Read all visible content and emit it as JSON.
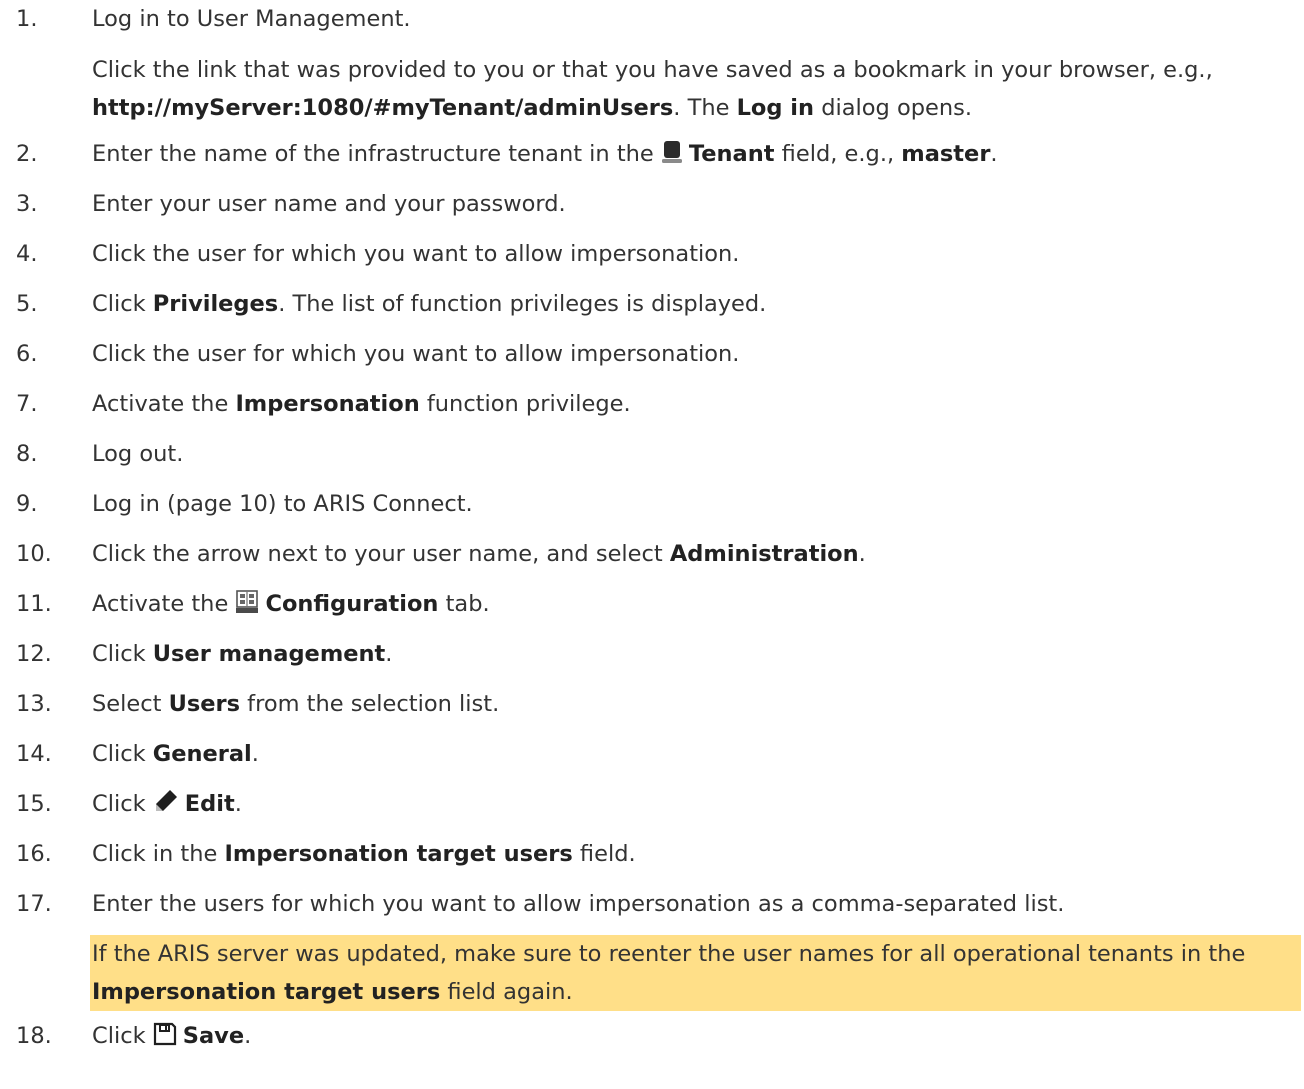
{
  "steps": [
    {
      "num": "1.",
      "title": "Log in to User Management.",
      "detail_pre": "Click the link that was provided to you or that you have saved as a bookmark in your browser, e.g., ",
      "detail_url": "http://myServer:1080/#myTenant/adminUsers",
      "detail_mid": ". The ",
      "detail_bold": "Log in",
      "detail_post": " dialog opens."
    },
    {
      "num": "2.",
      "pre": "Enter the name of the infrastructure tenant in the ",
      "icon": "tenant-icon",
      "bold": "Tenant",
      "mid": " field, e.g., ",
      "bold2": "master",
      "post": "."
    },
    {
      "num": "3.",
      "text": "Enter your user name and your password."
    },
    {
      "num": "4.",
      "text": "Click the user for which you want to allow impersonation."
    },
    {
      "num": "5.",
      "pre": "Click ",
      "bold": "Privileges",
      "post": ". The list of function privileges is displayed."
    },
    {
      "num": "6.",
      "text": "Click the user for which you want to allow impersonation."
    },
    {
      "num": "7.",
      "pre": "Activate the ",
      "bold": "Impersonation",
      "post": " function privilege."
    },
    {
      "num": "8.",
      "text": "Log out."
    },
    {
      "num": "9.",
      "text": "Log in (page 10) to ARIS Connect."
    },
    {
      "num": "10.",
      "pre": "Click the arrow next to your user name, and select ",
      "bold": "Administration",
      "post": "."
    },
    {
      "num": "11.",
      "pre": "Activate the ",
      "icon": "configuration-icon",
      "bold": "Configuration",
      "post": " tab."
    },
    {
      "num": "12.",
      "pre": "Click ",
      "bold": "User management",
      "post": "."
    },
    {
      "num": "13.",
      "pre": "Select ",
      "bold": "Users",
      "post": " from the selection list."
    },
    {
      "num": "14.",
      "pre": "Click ",
      "bold": "General",
      "post": "."
    },
    {
      "num": "15.",
      "pre": "Click ",
      "icon": "edit-icon",
      "bold": "Edit",
      "post": "."
    },
    {
      "num": "16.",
      "pre": "Click in the ",
      "bold": "Impersonation target users",
      "post": " field."
    },
    {
      "num": "17.",
      "text": "Enter the users for which you want to allow impersonation as a comma-separated list.",
      "note_pre": "If the ARIS server was updated, make sure to reenter the user names for all operational tenants in the ",
      "note_bold": "Impersonation target users",
      "note_post": " field again."
    },
    {
      "num": "18.",
      "pre": "Click ",
      "icon": "save-icon",
      "bold": "Save",
      "post": "."
    }
  ],
  "colors": {
    "text": "#333333",
    "note_background": "#FFDF88"
  }
}
